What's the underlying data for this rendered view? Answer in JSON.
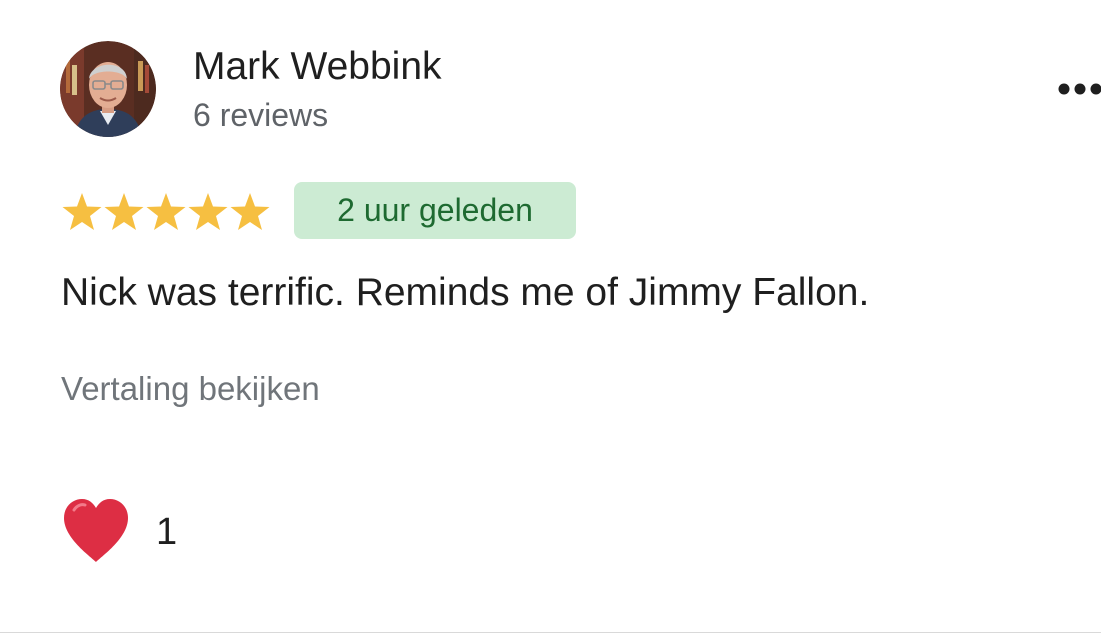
{
  "review": {
    "reviewer_name": "Mark Webbink",
    "review_count": "6 reviews",
    "rating": 5,
    "rating_max": 5,
    "time_ago": "2 uur geleden",
    "text": "Nick was terrific. Reminds me of Jimmy Fallon.",
    "translate_label": "Vertaling bekijken",
    "like_count": "1"
  },
  "icons": {
    "menu": "more-horizontal-icon",
    "star": "star-icon",
    "like": "heart-icon"
  },
  "colors": {
    "star": "#f6bf41",
    "badge_bg": "#ccebd3",
    "badge_text": "#1e6a31",
    "heart": "#dd2e44",
    "secondary_text": "#70757a"
  }
}
